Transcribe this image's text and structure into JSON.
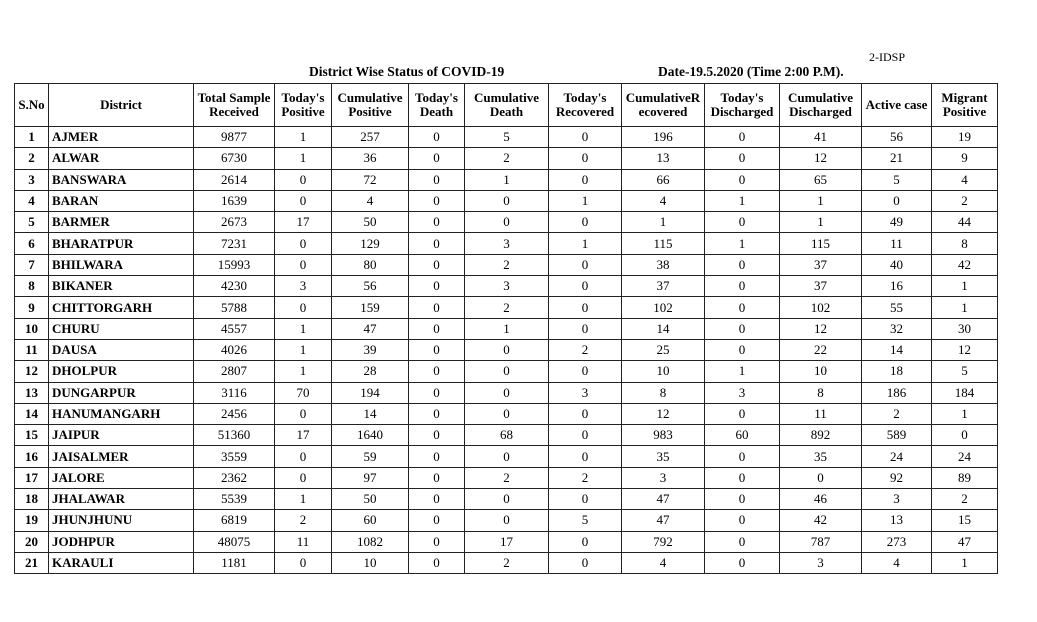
{
  "document": {
    "ref": "2-IDSP",
    "title": "District Wise Status of  COVID-19",
    "date": "Date-19.5.2020 (Time 2:00 P.M)."
  },
  "table": {
    "headers": [
      "S.No",
      "District",
      "Total Sample Received",
      "Today's Positive",
      "Cumulative Positive",
      "Today's Death",
      "Cumulative Death",
      "Today's Recovered",
      "CumulativeR ecovered",
      "Today's Discharged",
      "Cumulative Discharged",
      "Active  case",
      "Migrant Positive"
    ],
    "rows": [
      [
        "1",
        "AJMER",
        "9877",
        "1",
        "257",
        "0",
        "5",
        "0",
        "196",
        "0",
        "41",
        "56",
        "19"
      ],
      [
        "2",
        "ALWAR",
        "6730",
        "1",
        "36",
        "0",
        "2",
        "0",
        "13",
        "0",
        "12",
        "21",
        "9"
      ],
      [
        "3",
        "BANSWARA",
        "2614",
        "0",
        "72",
        "0",
        "1",
        "0",
        "66",
        "0",
        "65",
        "5",
        "4"
      ],
      [
        "4",
        "BARAN",
        "1639",
        "0",
        "4",
        "0",
        "0",
        "1",
        "4",
        "1",
        "1",
        "0",
        "2"
      ],
      [
        "5",
        "BARMER",
        "2673",
        "17",
        "50",
        "0",
        "0",
        "0",
        "1",
        "0",
        "1",
        "49",
        "44"
      ],
      [
        "6",
        "BHARATPUR",
        "7231",
        "0",
        "129",
        "0",
        "3",
        "1",
        "115",
        "1",
        "115",
        "11",
        "8"
      ],
      [
        "7",
        "BHILWARA",
        "15993",
        "0",
        "80",
        "0",
        "2",
        "0",
        "38",
        "0",
        "37",
        "40",
        "42"
      ],
      [
        "8",
        "BIKANER",
        "4230",
        "3",
        "56",
        "0",
        "3",
        "0",
        "37",
        "0",
        "37",
        "16",
        "1"
      ],
      [
        "9",
        "CHITTORGARH",
        "5788",
        "0",
        "159",
        "0",
        "2",
        "0",
        "102",
        "0",
        "102",
        "55",
        "1"
      ],
      [
        "10",
        "CHURU",
        "4557",
        "1",
        "47",
        "0",
        "1",
        "0",
        "14",
        "0",
        "12",
        "32",
        "30"
      ],
      [
        "11",
        "DAUSA",
        "4026",
        "1",
        "39",
        "0",
        "0",
        "2",
        "25",
        "0",
        "22",
        "14",
        "12"
      ],
      [
        "12",
        "DHOLPUR",
        "2807",
        "1",
        "28",
        "0",
        "0",
        "0",
        "10",
        "1",
        "10",
        "18",
        "5"
      ],
      [
        "13",
        "DUNGARPUR",
        "3116",
        "70",
        "194",
        "0",
        "0",
        "3",
        "8",
        "3",
        "8",
        "186",
        "184"
      ],
      [
        "14",
        "HANUMANGARH",
        "2456",
        "0",
        "14",
        "0",
        "0",
        "0",
        "12",
        "0",
        "11",
        "2",
        "1"
      ],
      [
        "15",
        "JAIPUR",
        "51360",
        "17",
        "1640",
        "0",
        "68",
        "0",
        "983",
        "60",
        "892",
        "589",
        "0"
      ],
      [
        "16",
        "JAISALMER",
        "3559",
        "0",
        "59",
        "0",
        "0",
        "0",
        "35",
        "0",
        "35",
        "24",
        "24"
      ],
      [
        "17",
        "JALORE",
        "2362",
        "0",
        "97",
        "0",
        "2",
        "2",
        "3",
        "0",
        "0",
        "92",
        "89"
      ],
      [
        "18",
        "JHALAWAR",
        "5539",
        "1",
        "50",
        "0",
        "0",
        "0",
        "47",
        "0",
        "46",
        "3",
        "2"
      ],
      [
        "19",
        "JHUNJHUNU",
        "6819",
        "2",
        "60",
        "0",
        "0",
        "5",
        "47",
        "0",
        "42",
        "13",
        "15"
      ],
      [
        "20",
        "JODHPUR",
        "48075",
        "11",
        "1082",
        "0",
        "17",
        "0",
        "792",
        "0",
        "787",
        "273",
        "47"
      ],
      [
        "21",
        "KARAULI",
        "1181",
        "0",
        "10",
        "0",
        "2",
        "0",
        "4",
        "0",
        "3",
        "4",
        "1"
      ]
    ]
  }
}
